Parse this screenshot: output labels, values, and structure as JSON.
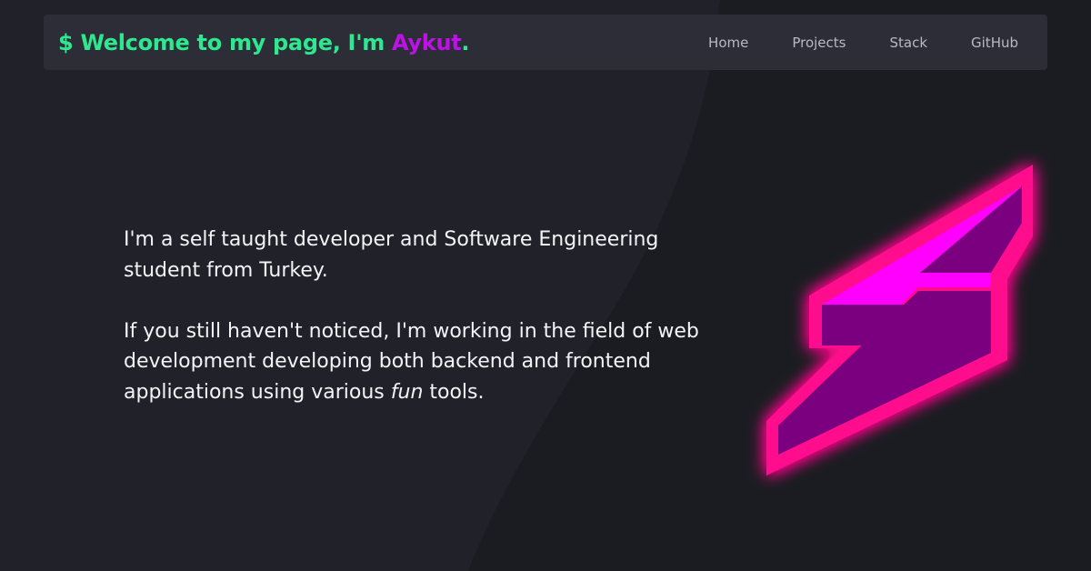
{
  "header": {
    "brand_prefix": "$ Welcome to my page, I'm ",
    "brand_name": "Aykut",
    "brand_suffix": ".",
    "nav": [
      {
        "label": "Home"
      },
      {
        "label": "Projects"
      },
      {
        "label": "Stack"
      },
      {
        "label": "GitHub"
      }
    ]
  },
  "intro": {
    "paragraph1": "I'm a self taught developer and Software Engineering student from Turkey.",
    "paragraph2_before": "If you still haven't noticed, I'm working in the field of web development developing both backend and frontend applications using various ",
    "paragraph2_emphasis": "fun",
    "paragraph2_after": " tools."
  },
  "colors": {
    "background": "#1b1c22",
    "navbar": "#2c2d37",
    "brand_green": "#2ee890",
    "brand_purple": "#c010e8",
    "bolt_pink": "#ff0a8c",
    "bolt_magenta": "#ff00ff",
    "bolt_purple": "#7a0080"
  },
  "icons": {
    "hero": "lightning-bolt-icon"
  }
}
